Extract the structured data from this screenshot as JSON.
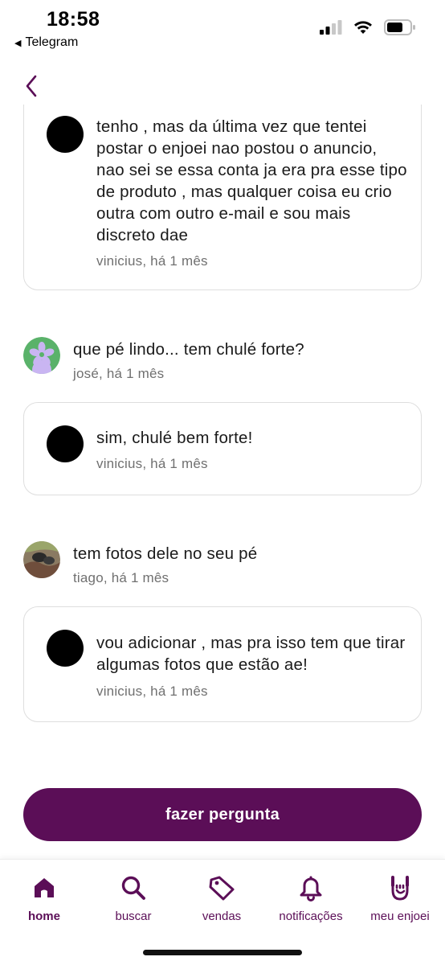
{
  "status_bar": {
    "time": "18:58",
    "back_app": "Telegram"
  },
  "colors": {
    "brand": "#5b0e57",
    "text": "#1a1a1a",
    "meta": "#707070",
    "border": "#dedede"
  },
  "comments": [
    {
      "type": "reply",
      "text": "tenho , mas da última vez que tentei postar o enjoei nao postou o anuncio, nao sei se essa conta ja era pra esse tipo de produto , mas qualquer coisa eu crio outra com outro e-mail e sou mais discreto dae",
      "meta": "vinicius, há 1 mês"
    },
    {
      "type": "question",
      "avatar": "flower-avatar",
      "text": "que pé lindo... tem chulé forte?",
      "meta": "josé, há 1 mês"
    },
    {
      "type": "reply",
      "text": "sim, chulé bem forte!",
      "meta": "vinicius, há 1 mês"
    },
    {
      "type": "question",
      "avatar": "photo-avatar",
      "text": "tem fotos dele no seu pé",
      "meta": "tiago, há 1 mês"
    },
    {
      "type": "reply",
      "text": "vou adicionar , mas pra isso tem que tirar algumas fotos que estão ae!",
      "meta": "vinicius, há 1 mês"
    }
  ],
  "ask_button": "fazer pergunta",
  "tabbar": [
    {
      "label": "home",
      "icon": "home-icon",
      "active": true
    },
    {
      "label": "buscar",
      "icon": "search-icon",
      "active": false
    },
    {
      "label": "vendas",
      "icon": "tag-icon",
      "active": false
    },
    {
      "label": "notificações",
      "icon": "bell-icon",
      "active": false
    },
    {
      "label": "meu enjoei",
      "icon": "rock-hand-icon",
      "active": false
    }
  ]
}
